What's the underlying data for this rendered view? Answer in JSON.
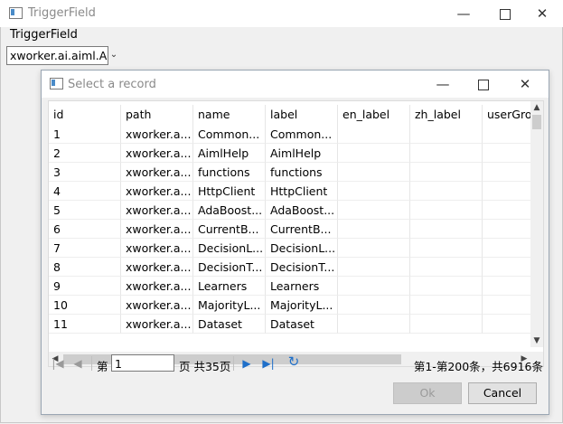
{
  "window": {
    "title": "TriggerField"
  },
  "form": {
    "trigger_label": "TriggerField",
    "trigger_value": "xworker.ai.aiml.Ai",
    "trigger_icon": "chevron-down-icon"
  },
  "dialog": {
    "title": "Select a record"
  },
  "table": {
    "columns": [
      "id",
      "path",
      "name",
      "label",
      "en_label",
      "zh_label",
      "userGro"
    ],
    "rows": [
      [
        "1",
        "xworker.a...",
        "Common...",
        "Common...",
        "",
        "",
        ""
      ],
      [
        "2",
        "xworker.a...",
        "AimlHelp",
        "AimlHelp",
        "",
        "",
        ""
      ],
      [
        "3",
        "xworker.a...",
        "functions",
        "functions",
        "",
        "",
        ""
      ],
      [
        "4",
        "xworker.a...",
        "HttpClient",
        "HttpClient",
        "",
        "",
        ""
      ],
      [
        "5",
        "xworker.a...",
        "AdaBoost...",
        "AdaBoost...",
        "",
        "",
        ""
      ],
      [
        "6",
        "xworker.a...",
        "CurrentB...",
        "CurrentB...",
        "",
        "",
        ""
      ],
      [
        "7",
        "xworker.a...",
        "DecisionL...",
        "DecisionL...",
        "",
        "",
        ""
      ],
      [
        "8",
        "xworker.a...",
        "DecisionT...",
        "DecisionT...",
        "",
        "",
        ""
      ],
      [
        "9",
        "xworker.a...",
        "Learners",
        "Learners",
        "",
        "",
        ""
      ],
      [
        "10",
        "xworker.a...",
        "MajorityL...",
        "MajorityL...",
        "",
        "",
        ""
      ],
      [
        "11",
        "xworker.a...",
        "Dataset",
        "Dataset",
        "",
        "",
        ""
      ]
    ]
  },
  "pager": {
    "prefix": "第",
    "page_value": "1",
    "suffix": "页 共35页",
    "summary": "第1-第200条，共6916条"
  },
  "buttons": {
    "ok": "Ok",
    "cancel": "Cancel"
  },
  "colors": {
    "accent": "#1f6fc9",
    "disabled": "#9a9a9a"
  }
}
